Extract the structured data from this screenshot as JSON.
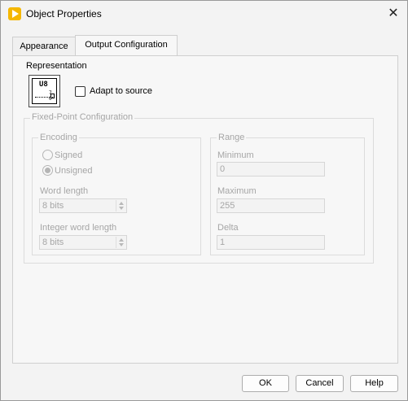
{
  "window": {
    "title": "Object Properties"
  },
  "tabs": [
    {
      "label": "Appearance",
      "active": false
    },
    {
      "label": "Output Configuration",
      "active": true
    }
  ],
  "representation": {
    "label": "Representation",
    "icon_type": "U8",
    "icon_subscript": "7 0",
    "adapt_to_source_label": "Adapt to source",
    "adapt_to_source_checked": false
  },
  "fixed_point": {
    "title": "Fixed-Point Configuration",
    "encoding": {
      "title": "Encoding",
      "signed_label": "Signed",
      "unsigned_label": "Unsigned",
      "selected": "Unsigned",
      "word_length_label": "Word length",
      "word_length_value": "8 bits",
      "integer_word_length_label": "Integer word length",
      "integer_word_length_value": "8 bits"
    },
    "range": {
      "title": "Range",
      "minimum_label": "Minimum",
      "minimum_value": "0",
      "maximum_label": "Maximum",
      "maximum_value": "255",
      "delta_label": "Delta",
      "delta_value": "1"
    }
  },
  "buttons": {
    "ok": "OK",
    "cancel": "Cancel",
    "help": "Help"
  },
  "colors": {
    "app_icon": "#f5b700",
    "disabled_text": "#a6a6a6"
  }
}
